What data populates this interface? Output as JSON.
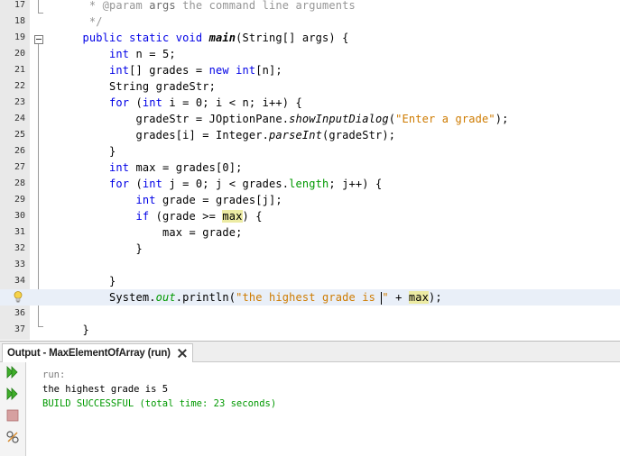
{
  "editor": {
    "lines": [
      {
        "num": "17"
      },
      {
        "num": "18"
      },
      {
        "num": "19"
      },
      {
        "num": "20"
      },
      {
        "num": "21"
      },
      {
        "num": "22"
      },
      {
        "num": "23"
      },
      {
        "num": "24"
      },
      {
        "num": "25"
      },
      {
        "num": "26"
      },
      {
        "num": "27"
      },
      {
        "num": "28"
      },
      {
        "num": "29"
      },
      {
        "num": "30"
      },
      {
        "num": "31"
      },
      {
        "num": "32"
      },
      {
        "num": "33"
      },
      {
        "num": "34"
      },
      {
        "num": ""
      },
      {
        "num": "36"
      },
      {
        "num": "37"
      }
    ],
    "current_line_icon": "lightbulb-hint-icon",
    "colors": {
      "keyword": "#0000e6",
      "comment": "#969696",
      "string": "#ce7b00",
      "field": "#009900",
      "highlight": "#eceba3",
      "current_line": "#e9eff8",
      "gutter": "#e9e9e9"
    }
  },
  "output": {
    "tab_label": "Output - MaxElementOfArray (run)",
    "console": {
      "run": "run:",
      "result": "the highest grade is 5",
      "build": "BUILD SUCCESSFUL (total time: 23 seconds)"
    },
    "tool_icons": [
      "rerun-icon",
      "rerun-with-options-icon",
      "stop-icon",
      "settings-icon"
    ]
  }
}
